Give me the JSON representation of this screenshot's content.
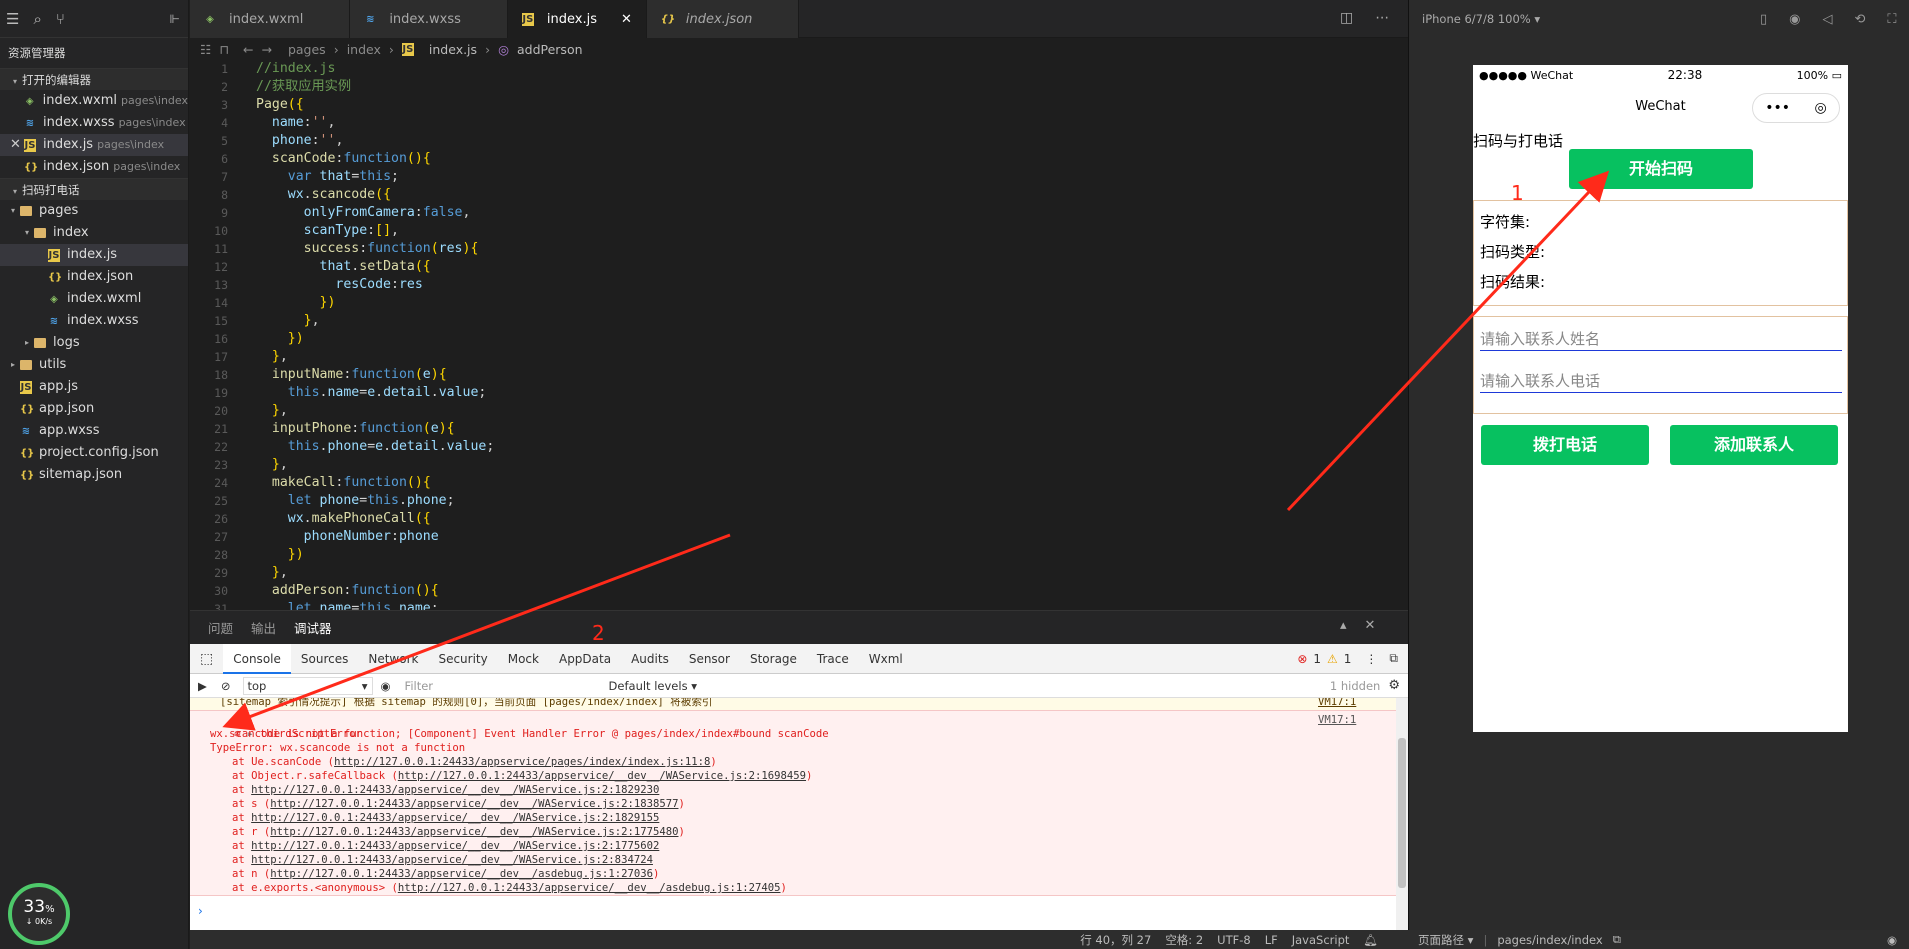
{
  "sidebar": {
    "title": "资源管理器",
    "open_editors_title": "打开的编辑器",
    "open_editors": [
      {
        "name": "index.wxml",
        "path": "pages\\index",
        "kind": "wxml"
      },
      {
        "name": "index.wxss",
        "path": "pages\\index",
        "kind": "wxss"
      },
      {
        "name": "index.js",
        "path": "pages\\index",
        "kind": "js"
      },
      {
        "name": "index.json",
        "path": "pages\\index",
        "kind": "json"
      }
    ],
    "project_title": "扫码打电话",
    "tree": [
      {
        "name": "pages",
        "kind": "folder",
        "depth": 0
      },
      {
        "name": "index",
        "kind": "folder",
        "depth": 1
      },
      {
        "name": "index.js",
        "kind": "js",
        "depth": 2
      },
      {
        "name": "index.json",
        "kind": "json",
        "depth": 2
      },
      {
        "name": "index.wxml",
        "kind": "wxml",
        "depth": 2
      },
      {
        "name": "index.wxss",
        "kind": "wxss",
        "depth": 2
      },
      {
        "name": "logs",
        "kind": "folder",
        "depth": 1
      },
      {
        "name": "utils",
        "kind": "folder",
        "depth": 0
      },
      {
        "name": "app.js",
        "kind": "js",
        "depth": 0
      },
      {
        "name": "app.json",
        "kind": "json",
        "depth": 0
      },
      {
        "name": "app.wxss",
        "kind": "wxss",
        "depth": 0
      },
      {
        "name": "project.config.json",
        "kind": "json",
        "depth": 0
      },
      {
        "name": "sitemap.json",
        "kind": "json",
        "depth": 0
      }
    ]
  },
  "tabs": [
    {
      "label": "index.wxml",
      "kind": "wxml"
    },
    {
      "label": "index.wxss",
      "kind": "wxss"
    },
    {
      "label": "index.js",
      "kind": "js",
      "active": true
    },
    {
      "label": "index.json",
      "kind": "json"
    }
  ],
  "breadcrumb": {
    "p1": "pages",
    "p2": "index",
    "p3": "index.js",
    "p4": "addPerson"
  },
  "code_lines": [
    "//index.js",
    "//获取应用实例",
    "Page({",
    "  name:'',",
    "  phone:'',",
    "  scanCode:function(){",
    "    var that=this;",
    "    wx.scancode({",
    "      onlyFromCamera:false,",
    "      scanType:[],",
    "      success:function(res){",
    "        that.setData({",
    "          resCode:res",
    "        })",
    "      },",
    "    })",
    "  },",
    "  inputName:function(e){",
    "    this.name=e.detail.value;",
    "  },",
    "  inputPhone:function(e){",
    "    this.phone=e.detail.value;",
    "  },",
    "  makeCall:function(){",
    "    let phone=this.phone;",
    "    wx.makePhoneCall({",
    "      phoneNumber:phone",
    "    })",
    "  },",
    "  addPerson:function(){",
    "    let name=this.name;"
  ],
  "panel": {
    "tabs": [
      "问题",
      "输出",
      "调试器"
    ]
  },
  "devtools": {
    "tabs": [
      "Console",
      "Sources",
      "Network",
      "Security",
      "Mock",
      "AppData",
      "Audits",
      "Sensor",
      "Storage",
      "Trace",
      "Wxml"
    ],
    "errors": "1",
    "warnings": "1",
    "context": "top",
    "filter_placeholder": "Filter",
    "levels": "Default levels",
    "hidden": "1 hidden"
  },
  "console": {
    "warn_line": "[sitemap 索引情况提示] 根据 sitemap 的规则[0]，当前页面 [pages/index/index] 将被索引",
    "warn_src": "VM17:1",
    "err_title": "thirdScriptError",
    "err_src": "VM17:1",
    "err_lines": [
      "wx.scancode is not a function; [Component] Event Handler Error @ pages/index/index#bound scanCode",
      "TypeError: wx.scancode is not a function"
    ],
    "stack": [
      {
        "pre": "at Ue.scanCode (",
        "url": "http://127.0.0.1:24433/appservice/pages/index/index.js:11:8",
        "post": ")"
      },
      {
        "pre": "at Object.r.safeCallback (",
        "url": "http://127.0.0.1:24433/appservice/__dev__/WAService.js:2:1698459",
        "post": ")"
      },
      {
        "pre": "at ",
        "url": "http://127.0.0.1:24433/appservice/__dev__/WAService.js:2:1829230",
        "post": ""
      },
      {
        "pre": "at s (",
        "url": "http://127.0.0.1:24433/appservice/__dev__/WAService.js:2:1838577",
        "post": ")"
      },
      {
        "pre": "at ",
        "url": "http://127.0.0.1:24433/appservice/__dev__/WAService.js:2:1829155",
        "post": ""
      },
      {
        "pre": "at r (",
        "url": "http://127.0.0.1:24433/appservice/__dev__/WAService.js:2:1775480",
        "post": ")"
      },
      {
        "pre": "at ",
        "url": "http://127.0.0.1:24433/appservice/__dev__/WAService.js:2:1775602",
        "post": ""
      },
      {
        "pre": "at ",
        "url": "http://127.0.0.1:24433/appservice/__dev__/WAService.js:2:834724",
        "post": ""
      },
      {
        "pre": "at n (",
        "url": "http://127.0.0.1:24433/appservice/__dev__/asdebug.js:1:27036",
        "post": ")"
      },
      {
        "pre": "at e.exports.<anonymous> (",
        "url": "http://127.0.0.1:24433/appservice/__dev__/asdebug.js:1:27405",
        "post": ")"
      }
    ]
  },
  "status": {
    "pos": "行 40，列 27",
    "indent": "空格: 2",
    "enc": "UTF-8",
    "eol": "LF",
    "lang": "JavaScript"
  },
  "perf": {
    "pct": "33",
    "unit": "%",
    "speed": "0K/s"
  },
  "simulator": {
    "device": "iPhone 6/7/8 100% ▾",
    "carrier": "●●●●● WeChat",
    "time": "22:38",
    "battery": "100%",
    "nav_title": "WeChat",
    "heading": "扫码与打电话",
    "scan_btn": "开始扫码",
    "charset": "字符集:",
    "scan_type": "扫码类型:",
    "scan_result": "扫码结果:",
    "name_ph": "请输入联系人姓名",
    "phone_ph": "请输入联系人电话",
    "call_btn": "拨打电话",
    "add_btn": "添加联系人",
    "path_label": "页面路径 ▾",
    "path": "pages/index/index"
  },
  "annotations": {
    "label1": "1",
    "label2": "2",
    "color": "#ff2a1a"
  }
}
